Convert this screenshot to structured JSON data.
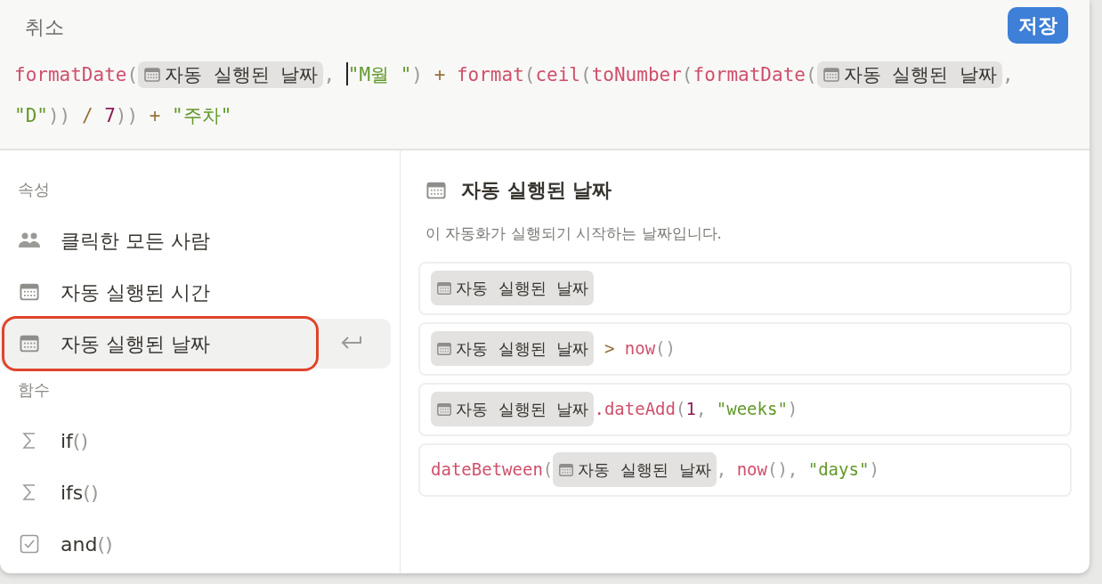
{
  "header": {
    "cancel": "취소",
    "save": "저장"
  },
  "formula": [
    {
      "kind": "func",
      "text": "formatDate",
      "cursor": false
    },
    {
      "kind": "punct",
      "text": "(",
      "cursor": false
    },
    {
      "kind": "chip",
      "text": "자동 실행된 날짜",
      "cursor": false
    },
    {
      "kind": "punct",
      "text": ", ",
      "cursor": false
    },
    {
      "kind": "string",
      "text": "\"M월 \"",
      "cursor": true
    },
    {
      "kind": "punct",
      "text": ") ",
      "cursor": false
    },
    {
      "kind": "op",
      "text": "+ ",
      "cursor": false
    },
    {
      "kind": "func",
      "text": "format",
      "cursor": false
    },
    {
      "kind": "punct",
      "text": "(",
      "cursor": false
    },
    {
      "kind": "func",
      "text": "ceil",
      "cursor": false
    },
    {
      "kind": "punct",
      "text": "(",
      "cursor": false
    },
    {
      "kind": "func",
      "text": "toNumber",
      "cursor": false
    },
    {
      "kind": "punct",
      "text": "(",
      "cursor": false
    },
    {
      "kind": "func",
      "text": "formatDate",
      "cursor": false
    },
    {
      "kind": "punct",
      "text": "(",
      "cursor": false
    },
    {
      "kind": "chip",
      "text": "자동 실행된 날짜",
      "cursor": false
    },
    {
      "kind": "punct",
      "text": ", ",
      "cursor": false
    },
    {
      "kind": "string",
      "text": "\"D\"",
      "cursor": false
    },
    {
      "kind": "punct",
      "text": ")) ",
      "cursor": false
    },
    {
      "kind": "op",
      "text": "/ ",
      "cursor": false
    },
    {
      "kind": "number",
      "text": "7",
      "cursor": false
    },
    {
      "kind": "punct",
      "text": ")) ",
      "cursor": false
    },
    {
      "kind": "op",
      "text": "+ ",
      "cursor": false
    },
    {
      "kind": "string",
      "text": "\"주차\"",
      "cursor": false
    }
  ],
  "sidebar": [
    {
      "heading": "속성",
      "items": [
        {
          "kind": "person",
          "name": "클릭한 모든 사람",
          "selected": false,
          "annotated": false
        },
        {
          "kind": "date",
          "name": "자동 실행된 시간",
          "selected": false,
          "annotated": false
        },
        {
          "kind": "date",
          "name": "자동 실행된 날짜",
          "selected": true,
          "annotated": true
        }
      ]
    },
    {
      "heading": "함수",
      "items": [
        {
          "kind": "function",
          "name": "if",
          "parens": "()",
          "selected": false,
          "annotated": false
        },
        {
          "kind": "function",
          "name": "ifs",
          "parens": "()",
          "selected": false,
          "annotated": false
        },
        {
          "kind": "boolean",
          "name": "and",
          "parens": "()",
          "selected": false,
          "annotated": false
        }
      ]
    }
  ],
  "detail": {
    "title": "자동 실행된 날짜",
    "description": "이 자동화가 실행되기 시작하는 날짜입니다.",
    "examples": [
      [
        {
          "kind": "chip",
          "text": "자동 실행된 날짜"
        }
      ],
      [
        {
          "kind": "chip",
          "text": "자동 실행된 날짜"
        },
        {
          "kind": "op",
          "text": " > "
        },
        {
          "kind": "func",
          "text": "now"
        },
        {
          "kind": "punct",
          "text": "()"
        }
      ],
      [
        {
          "kind": "chip",
          "text": "자동 실행된 날짜"
        },
        {
          "kind": "func",
          "text": ".dateAdd"
        },
        {
          "kind": "punct",
          "text": "("
        },
        {
          "kind": "number",
          "text": "1"
        },
        {
          "kind": "punct",
          "text": ", "
        },
        {
          "kind": "string",
          "text": "\"weeks\""
        },
        {
          "kind": "punct",
          "text": ")"
        }
      ],
      [
        {
          "kind": "func",
          "text": "dateBetween"
        },
        {
          "kind": "punct",
          "text": "("
        },
        {
          "kind": "chip",
          "text": "자동 실행된 날짜"
        },
        {
          "kind": "punct",
          "text": ", "
        },
        {
          "kind": "func",
          "text": "now"
        },
        {
          "kind": "punct",
          "text": "(), "
        },
        {
          "kind": "string",
          "text": "\"days\""
        },
        {
          "kind": "punct",
          "text": ")"
        }
      ]
    ]
  }
}
